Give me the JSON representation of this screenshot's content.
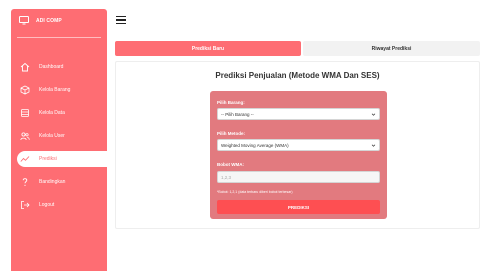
{
  "brand": {
    "name": "ADI COMP"
  },
  "sidebar": {
    "items": [
      {
        "label": "Dashboard",
        "icon": "home-icon"
      },
      {
        "label": "Kelola Barang",
        "icon": "box-icon"
      },
      {
        "label": "Kelola Data",
        "icon": "database-icon"
      },
      {
        "label": "Kelola User",
        "icon": "users-icon"
      },
      {
        "label": "Prediksi",
        "icon": "trend-icon",
        "active": true
      },
      {
        "label": "Bandingkan",
        "icon": "question-icon"
      },
      {
        "label": "Logout",
        "icon": "logout-icon"
      }
    ]
  },
  "tabs": [
    {
      "label": "Prediksi Baru",
      "active": true
    },
    {
      "label": "Riwayat Prediksi",
      "active": false
    }
  ],
  "main": {
    "title": "Prediksi Penjualan (Metode WMA Dan SES)",
    "form": {
      "barang_label": "Pilih Barang:",
      "barang_value": "-- Pilih Barang --",
      "metode_label": "Pilih Metode:",
      "metode_value": "Weighted Moving Average (WMA)",
      "bobot_label": "Bobot WMA:",
      "bobot_placeholder": "1,2,3",
      "hint": "*Bobot: 1,2,1 (data terbaru diberi bobot terbesar)",
      "submit_label": "PREDIKSI"
    }
  },
  "colors": {
    "primary": "#fe6d73",
    "form_bg": "#e27a7f",
    "submit": "#fe4f52"
  }
}
